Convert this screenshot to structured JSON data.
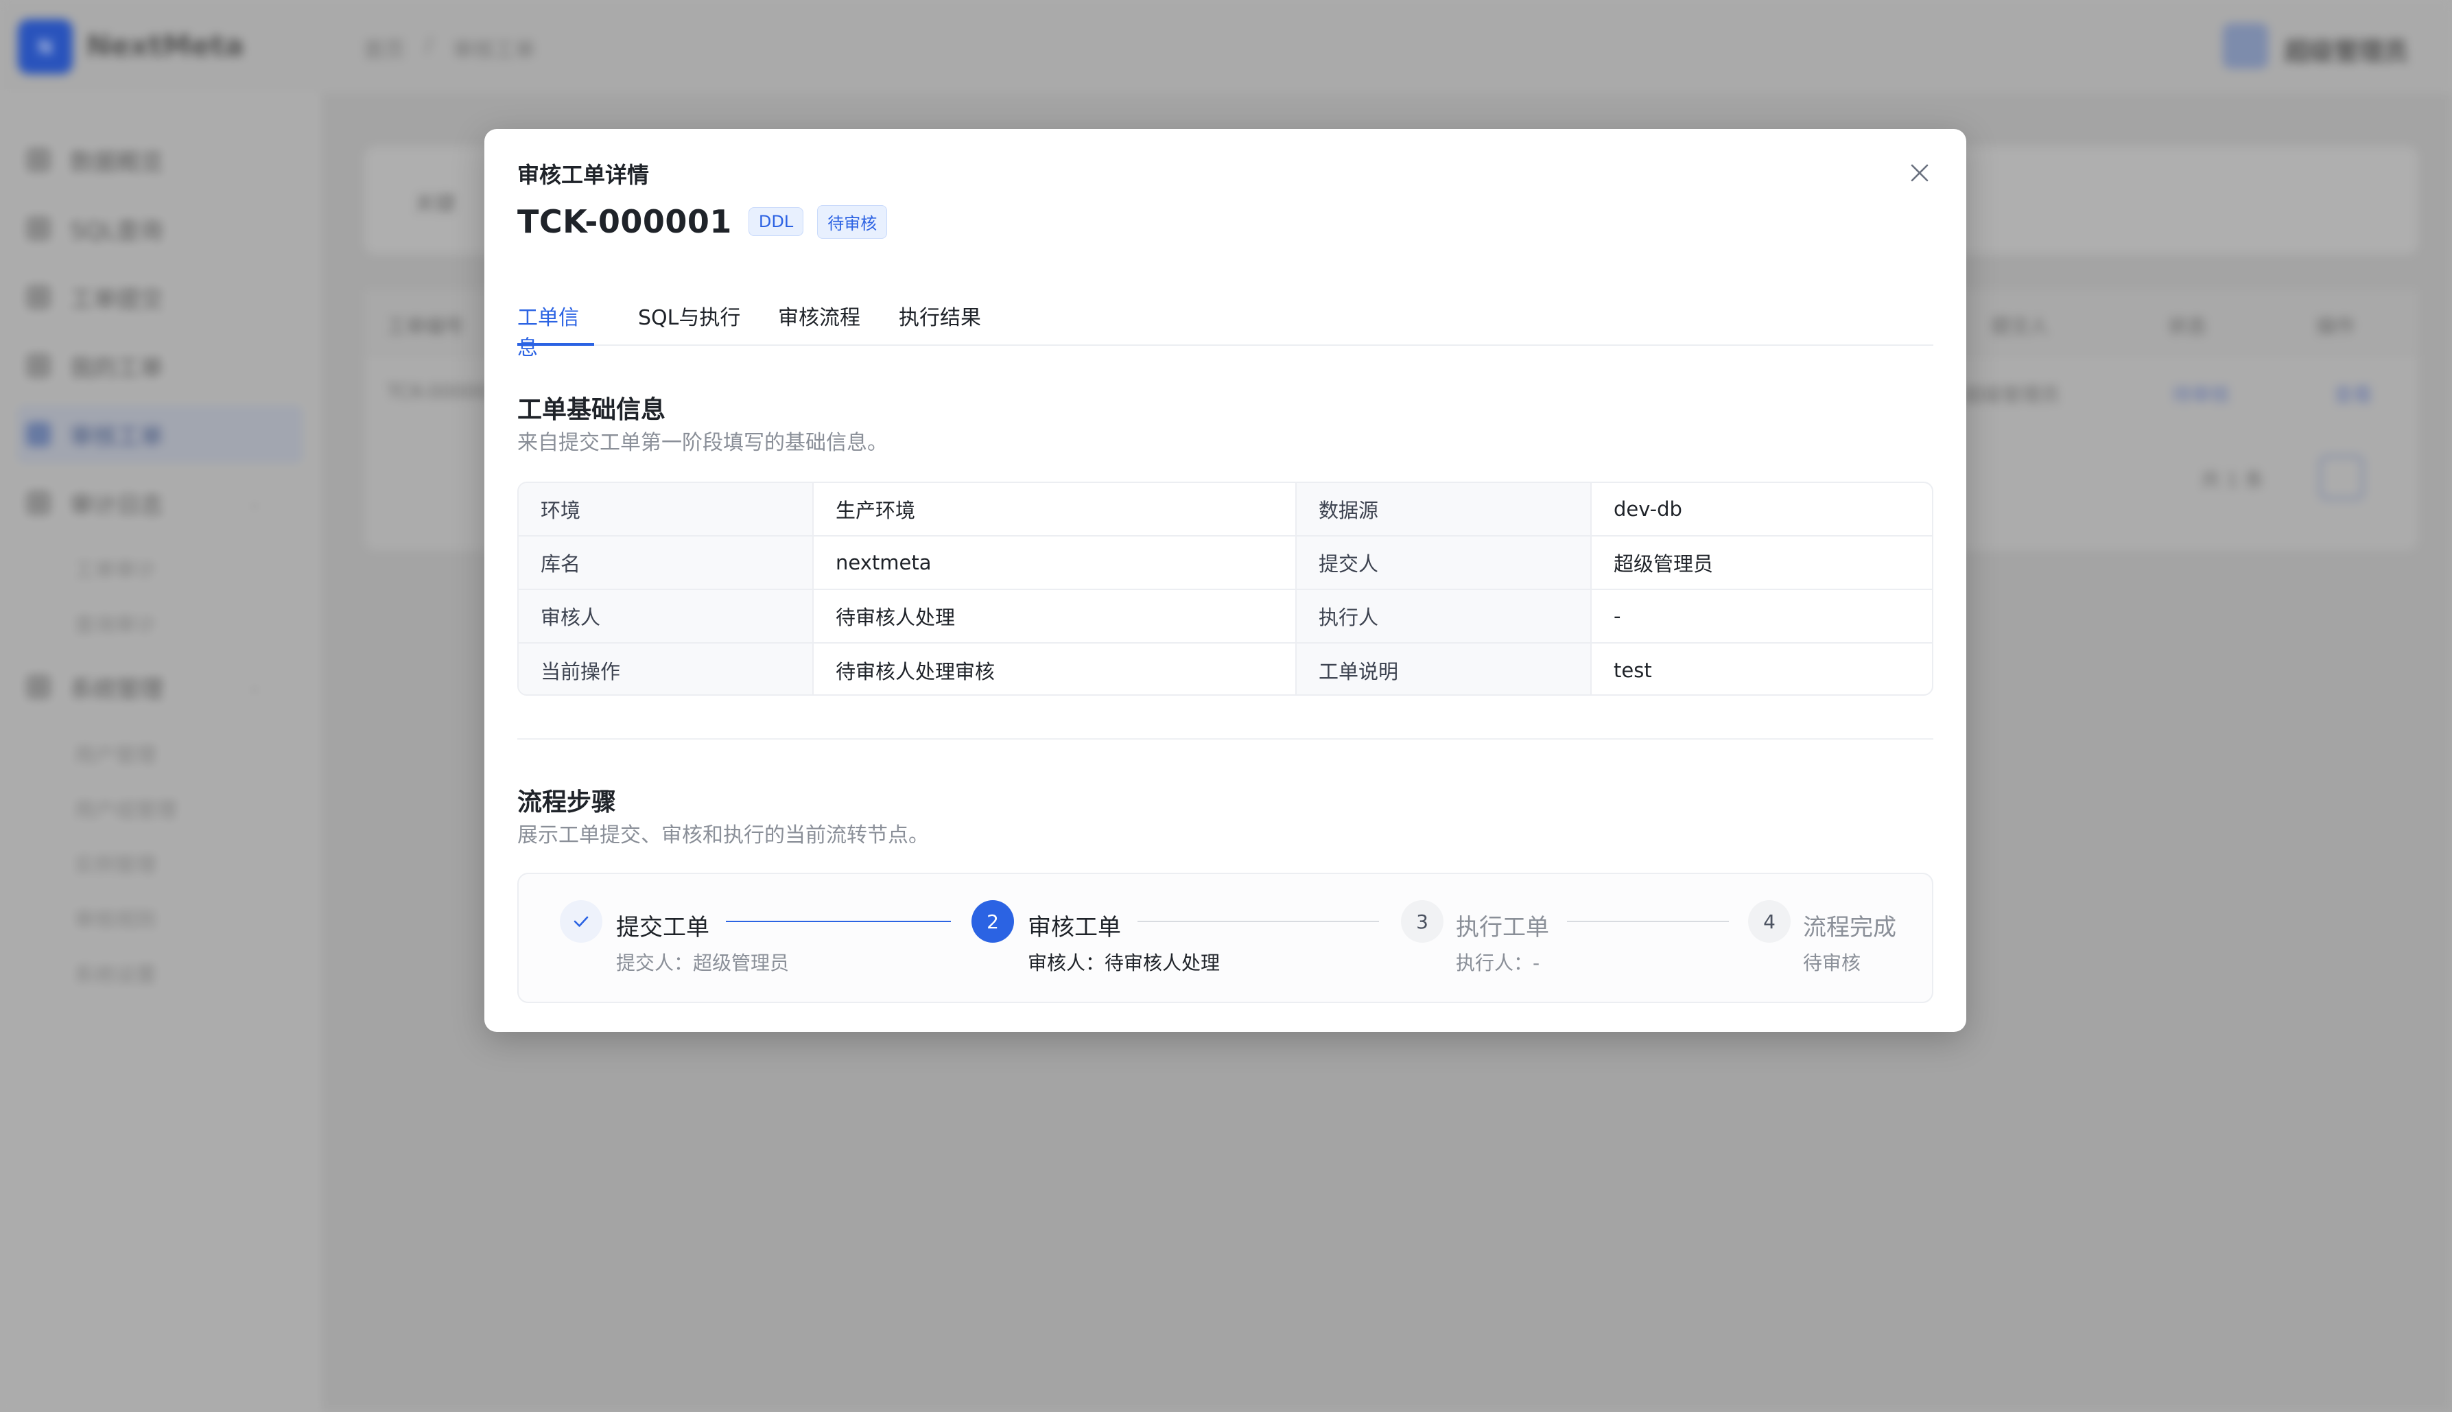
{
  "app": {
    "logo_letter": "N",
    "brand": "NextMeta",
    "breadcrumb": [
      "首页",
      "/",
      "审核工单"
    ],
    "user_name": "超级管理员"
  },
  "sidebar": {
    "items": [
      {
        "label": "数据概览"
      },
      {
        "label": "SQL查询"
      },
      {
        "label": "工单提交"
      },
      {
        "label": "我的工单"
      },
      {
        "label": "审核工单"
      },
      {
        "label": "审计日志"
      },
      {
        "label": "系统管理"
      }
    ],
    "audit_children": [
      "工单审计",
      "查询审计"
    ],
    "system_children": [
      "用户管理",
      "用户组管理",
      "实例管理",
      "审核规则",
      "系统设置"
    ]
  },
  "background": {
    "filter_label": "关键",
    "table_headers": [
      "工单编号",
      "提交人",
      "状态",
      "操作"
    ],
    "row": {
      "id": "TCK-00000",
      "submitter": "超级管理员",
      "status": "待审核",
      "action": "查看"
    },
    "pager_total": "共 1 条",
    "pager_page": "1"
  },
  "modal": {
    "title": "审核工单详情",
    "ticket_no": "TCK-000001",
    "tags": [
      "DDL",
      "待审核"
    ],
    "tabs": [
      "工单信息",
      "SQL与执行",
      "审核流程",
      "执行结果"
    ],
    "active_tab": "工单信息",
    "basic": {
      "title": "工单基础信息",
      "desc": "来自提交工单第一阶段填写的基础信息。",
      "rows": [
        {
          "l1": "环境",
          "v1": "生产环境",
          "l2": "数据源",
          "v2": "dev-db"
        },
        {
          "l1": "库名",
          "v1": "nextmeta",
          "l2": "提交人",
          "v2": "超级管理员"
        },
        {
          "l1": "审核人",
          "v1": "待审核人处理",
          "l2": "执行人",
          "v2": "-"
        },
        {
          "l1": "当前操作",
          "v1": "待审核人处理审核",
          "l2": "工单说明",
          "v2": "test"
        }
      ]
    },
    "flow": {
      "title": "流程步骤",
      "desc": "展示工单提交、审核和执行的当前流转节点。",
      "steps": [
        {
          "num": "",
          "title": "提交工单",
          "sub": "提交人：超级管理员",
          "state": "done"
        },
        {
          "num": "2",
          "title": "审核工单",
          "sub": "审核人：待审核人处理",
          "state": "active"
        },
        {
          "num": "3",
          "title": "执行工单",
          "sub": "执行人：-",
          "state": "wait"
        },
        {
          "num": "4",
          "title": "流程完成",
          "sub": "待审核",
          "state": "wait"
        }
      ]
    }
  },
  "colors": {
    "primary": "#2b63e3",
    "tag_bg": "#e8f0fe",
    "border": "#eceef2",
    "muted_text": "#8a8f98"
  }
}
